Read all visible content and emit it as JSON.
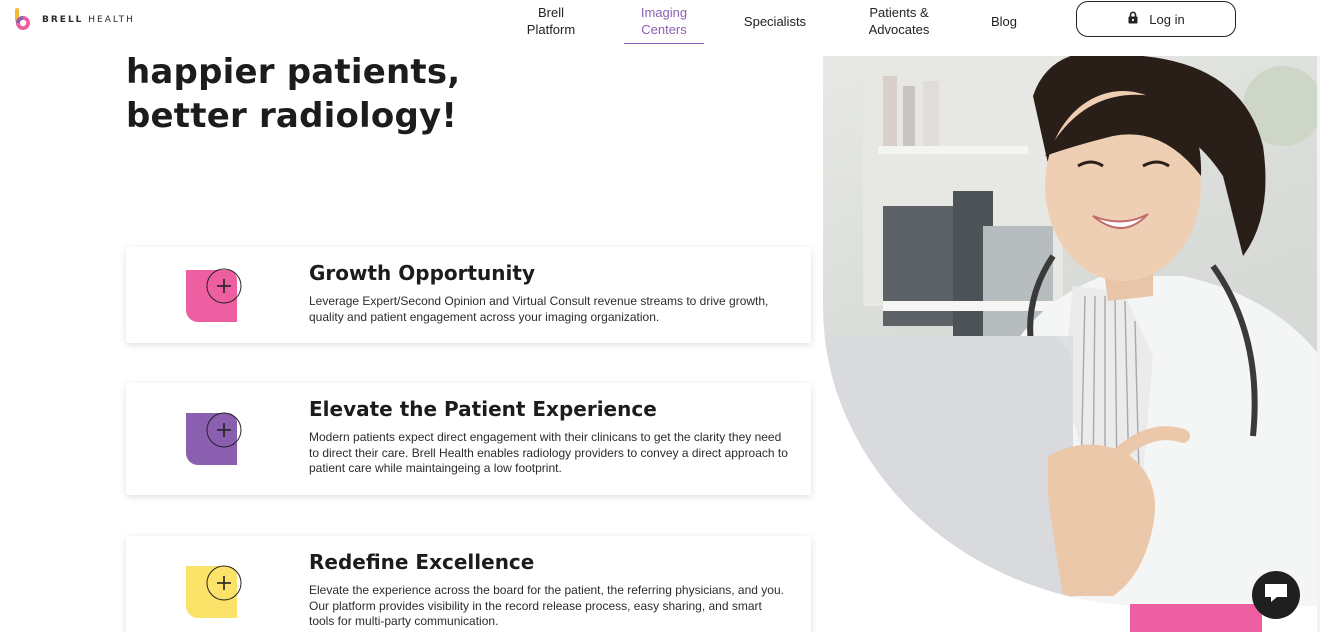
{
  "brand": {
    "name_bold": "BRELL",
    "name_light": " HEALTH"
  },
  "nav": {
    "items": [
      {
        "label_line1": "Brell",
        "label_line2": "Platform"
      },
      {
        "label_line1": "Imaging",
        "label_line2": "Centers"
      },
      {
        "label_line1": "Specialists",
        "label_line2": ""
      },
      {
        "label_line1": "Patients &",
        "label_line2": "Advocates"
      },
      {
        "label_line1": "Blog",
        "label_line2": ""
      }
    ],
    "active_index": 1,
    "login_label": "Log in"
  },
  "hero": {
    "headline_line1": "happier patients,",
    "headline_line2": "better radiology!"
  },
  "cards": [
    {
      "title": "Growth Opportunity",
      "description": "Leverage Expert/Second Opinion and Virtual Consult revenue streams to drive growth, quality and patient engagement across your imaging organization.",
      "icon": "plus-icon",
      "color": "#ee5fa1"
    },
    {
      "title": "Elevate the Patient Experience",
      "description": "Modern patients expect direct engagement with their clinicans to get the clarity they need to direct their care. Brell Health enables radiology providers to convey a direct approach to patient care while maintaingeing a low footprint.",
      "icon": "plus-icon",
      "color": "#8b5fb0"
    },
    {
      "title": "Redefine Excellence",
      "description": "Elevate the experience across the board for the patient, the referring physicians, and you. Our platform provides visibility in the record release process, easy sharing, and smart tools for multi-party communication.",
      "icon": "plus-icon",
      "color": "#fbe36a"
    }
  ],
  "colors": {
    "accent_purple": "#8a5fb3",
    "pink": "#ee5fa1",
    "purple": "#8b5fb0",
    "yellow": "#fbe36a",
    "dark": "#1f1f1f"
  }
}
